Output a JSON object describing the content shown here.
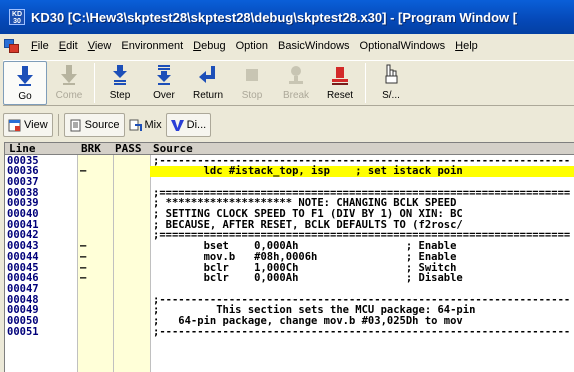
{
  "window": {
    "icon_text": "KD 30",
    "title": "KD30 [C:\\Hew3\\skptest28\\skptest28\\debug\\skptest28.x30] - [Program Window ["
  },
  "menu": [
    {
      "accel": "F",
      "rest": "ile"
    },
    {
      "accel": "E",
      "rest": "dit"
    },
    {
      "accel": "V",
      "rest": "iew"
    },
    {
      "accel": "",
      "rest": "Environment"
    },
    {
      "accel": "D",
      "rest": "ebug"
    },
    {
      "accel": "",
      "rest": "Option"
    },
    {
      "accel": "",
      "rest": "BasicWindows"
    },
    {
      "accel": "",
      "rest": "OptionalWindows"
    },
    {
      "accel": "H",
      "rest": "elp"
    }
  ],
  "toolbar": {
    "go": "Go",
    "come": "Come",
    "step": "Step",
    "over": "Over",
    "return": "Return",
    "stop": "Stop",
    "break": "Break",
    "reset": "Reset",
    "s": "S/..."
  },
  "views": {
    "view": "View",
    "source": "Source",
    "mix": "Mix",
    "di": "Di..."
  },
  "columns": {
    "line": "Line",
    "brk": "BRK",
    "pass": "PASS",
    "source": "Source"
  },
  "colors": {
    "highlight": "#ffff00",
    "title_bar": "#0548b7"
  },
  "rows": [
    {
      "line": "00035",
      "brk": "",
      "src": ";-----------------------------------------------------------------"
    },
    {
      "line": "00036",
      "brk": "–",
      "src": "        ldc #istack_top, isp    ; set istack poin",
      "highlight": true
    },
    {
      "line": "00037",
      "brk": "",
      "src": ""
    },
    {
      "line": "00038",
      "brk": "",
      "src": ";================================================================="
    },
    {
      "line": "00039",
      "brk": "",
      "src": "; ******************** NOTE: CHANGING BCLK SPEED"
    },
    {
      "line": "00040",
      "brk": "",
      "src": "; SETTING CLOCK SPEED TO F1 (DIV BY 1) ON XIN: BC"
    },
    {
      "line": "00041",
      "brk": "",
      "src": "; BECAUSE, AFTER RESET, BCLK DEFAULTS TO (f2rosc/"
    },
    {
      "line": "00042",
      "brk": "",
      "src": ";================================================================="
    },
    {
      "line": "00043",
      "brk": "–",
      "src": "        bset    0,000Ah                 ; Enable"
    },
    {
      "line": "00044",
      "brk": "–",
      "src": "        mov.b   #08h,0006h              ; Enable"
    },
    {
      "line": "00045",
      "brk": "–",
      "src": "        bclr    1,000Ch                 ; Switch"
    },
    {
      "line": "00046",
      "brk": "–",
      "src": "        bclr    0,000Ah                 ; Disable"
    },
    {
      "line": "00047",
      "brk": "",
      "src": ""
    },
    {
      "line": "00048",
      "brk": "",
      "src": ";-----------------------------------------------------------------"
    },
    {
      "line": "00049",
      "brk": "",
      "src": ";         This section sets the MCU package: 64-pin"
    },
    {
      "line": "00050",
      "brk": "",
      "src": ";   64-pin package, change mov.b #03,025Dh to mov"
    },
    {
      "line": "00051",
      "brk": "",
      "src": ";-----------------------------------------------------------------"
    }
  ]
}
